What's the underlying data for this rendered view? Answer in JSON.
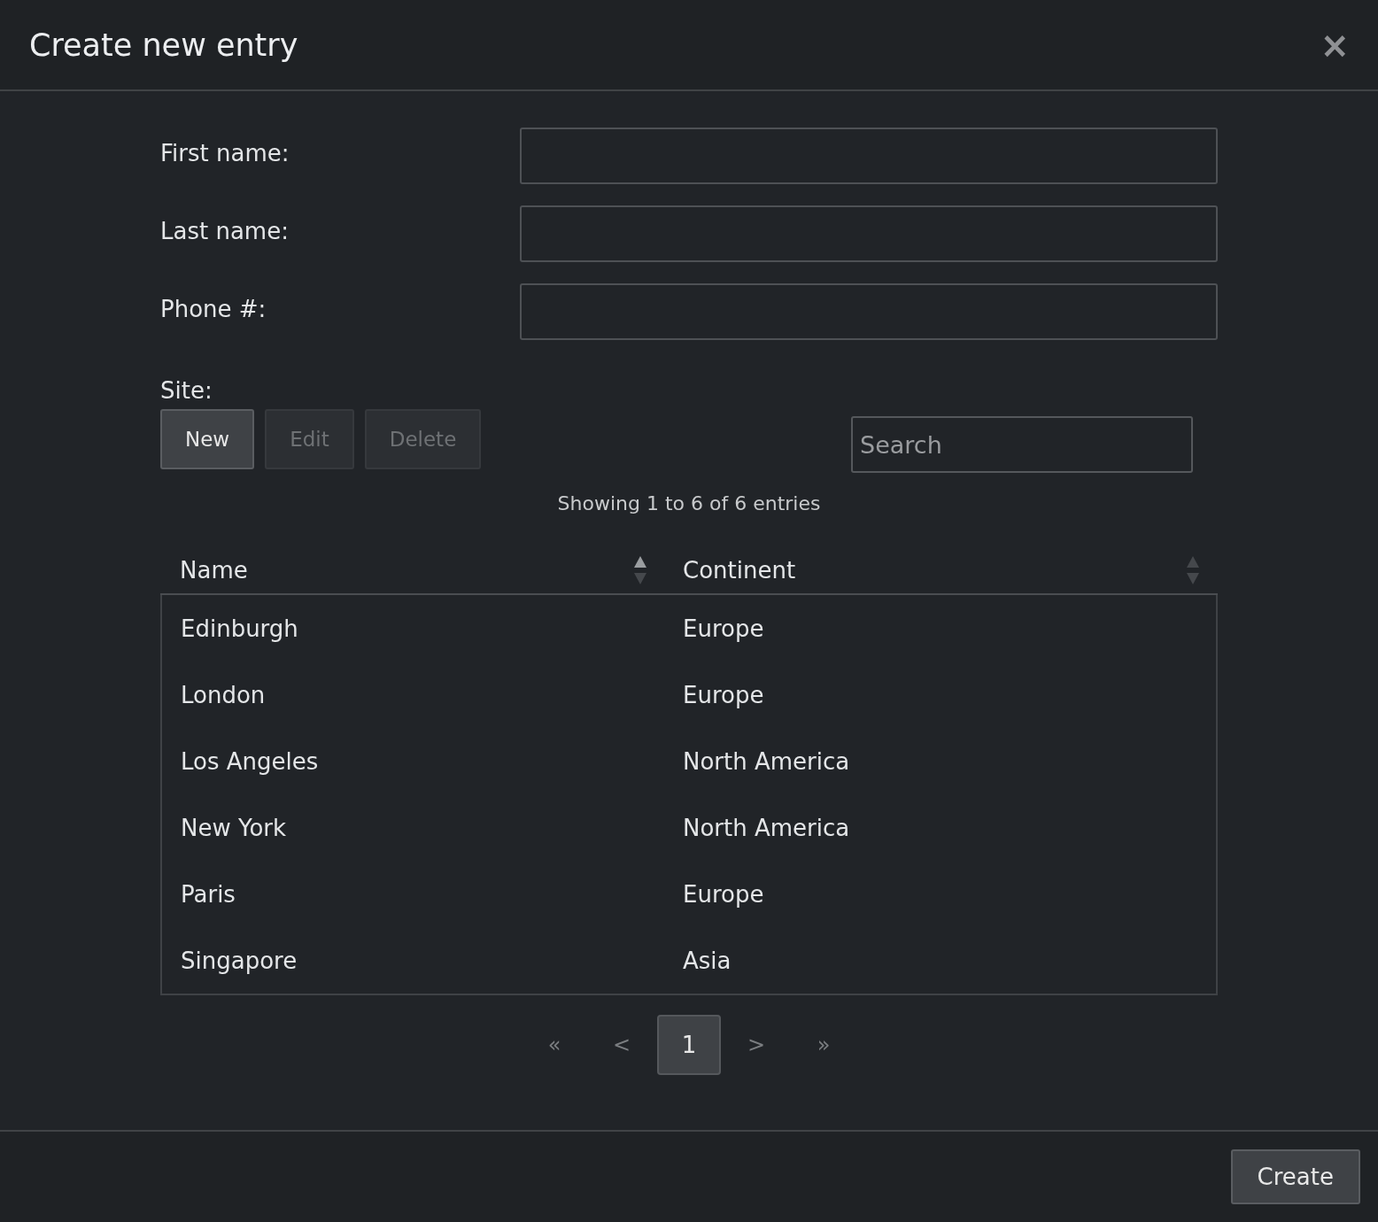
{
  "dialog": {
    "title": "Create new entry",
    "close": "×"
  },
  "fields": [
    {
      "label": "First name:"
    },
    {
      "label": "Last name:"
    },
    {
      "label": "Phone #:"
    }
  ],
  "site": {
    "label": "Site:",
    "buttons": [
      {
        "label": "New",
        "disabled": false
      },
      {
        "label": "Edit",
        "disabled": true
      },
      {
        "label": "Delete",
        "disabled": true
      }
    ],
    "search": {
      "placeholder": "Search"
    },
    "info": "Showing 1 to 6 of 6 entries",
    "table": {
      "columns": [
        {
          "label": "Name",
          "sorted": true
        },
        {
          "label": "Continent",
          "sorted": false
        }
      ],
      "rows": [
        [
          "Edinburgh",
          "Europe"
        ],
        [
          "London",
          "Europe"
        ],
        [
          "Los Angeles",
          "North America"
        ],
        [
          "New York",
          "North America"
        ],
        [
          "Paris",
          "Europe"
        ],
        [
          "Singapore",
          "Asia"
        ]
      ]
    },
    "pagination": [
      {
        "label": "«",
        "selected": false
      },
      {
        "label": "<",
        "selected": false
      },
      {
        "label": "1",
        "selected": true
      },
      {
        "label": ">",
        "selected": false
      },
      {
        "label": "»",
        "selected": false
      }
    ]
  },
  "footer": {
    "buttons": [
      {
        "label": "Create"
      }
    ]
  }
}
